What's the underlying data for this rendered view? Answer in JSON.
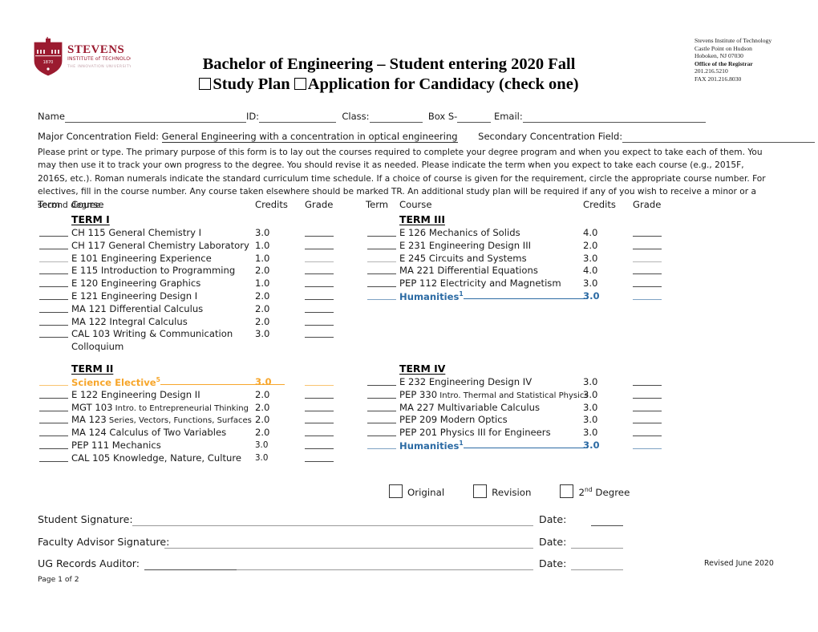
{
  "header": {
    "logo_name": "stevens-institute-logo",
    "logo_text_primary": "STEVENS",
    "logo_text_secondary": "INSTITUTE of TECHNOLOGY",
    "logo_text_tertiary": "THE INNOVATION UNIVERSITY",
    "logo_color": "#9B1B30",
    "title_line1": "Bachelor of Engineering – Student entering 2020 Fall",
    "checkbox1_label": "Study Plan",
    "checkbox2_label": "Application for Candidacy (check one)",
    "registrar": {
      "line1": "Stevens Institute of Technology",
      "line2": "Castle Point on Hudson",
      "line3": "Hoboken, NJ 07030",
      "line4": "Office of the Registrar",
      "line5": "201.216.5210",
      "line6": "FAX 201.216.8030"
    }
  },
  "identity": {
    "name_label": "Name",
    "id_label": "ID:",
    "class_label": "Class:",
    "box_label": "Box S-",
    "email_label": "Email:",
    "major_label": "Major Concentration Field:",
    "major_value": "General Engineering with a concentration in optical engineering",
    "secondary_label": "Secondary Concentration Field:"
  },
  "instructions": "Please print or type. The primary purpose of this form is to lay out the courses required to complete your degree program and when you expect to take each of them. You may then use it to track your own progress to the degree. You should revise it as needed. Please indicate the term when you expect to take each course (e.g., 2015F, 2016S, etc.). Roman numerals indicate the standard curriculum time schedule. If a choice of course is given for the requirement, circle the appropriate course number. For electives, fill in the course number. Any course taken elsewhere should be marked TR. An additional study plan will be required if any of you wish to receive a minor or a second degree.",
  "columns": {
    "term": "Term",
    "course": "Course",
    "credits": "Credits",
    "grade": "Grade"
  },
  "colors": {
    "accent_blue": "#2C6BA4",
    "accent_orange": "#F7A62B",
    "brand_maroon": "#9B1B30"
  },
  "terms": {
    "term1": {
      "heading": "TERM I",
      "rows": [
        {
          "course": "CH 115 General Chemistry I",
          "credits": "3.0"
        },
        {
          "course": "CH 117 General Chemistry Laboratory",
          "credits": "1.0"
        },
        {
          "course": "E 101 Engineering Experience",
          "credits": "1.0",
          "faint": true
        },
        {
          "course": "E 115 Introduction to Programming",
          "credits": "2.0"
        },
        {
          "course": "E 120 Engineering Graphics",
          "credits": "1.0"
        },
        {
          "course": "E 121 Engineering Design I",
          "credits": "2.0"
        },
        {
          "course": "MA 121 Differential Calculus",
          "credits": "2.0"
        },
        {
          "course": "MA 122 Integral Calculus",
          "credits": "2.0"
        },
        {
          "course": "CAL 103 Writing & Communication",
          "credits": "3.0",
          "continuation": "Colloquium"
        }
      ]
    },
    "term2": {
      "heading": "TERM II",
      "rows": [
        {
          "course": "Science Elective",
          "sup": "5",
          "fill": true,
          "credits": "3.0",
          "accent": "orange"
        },
        {
          "course": "E 122 Engineering Design II",
          "credits": "2.0"
        },
        {
          "course": "MGT 103",
          "detail": "Intro. to Entrepreneurial Thinking",
          "credits": "2.0"
        },
        {
          "course": "MA 123",
          "detail": "Series, Vectors, Functions, Surfaces",
          "credits": "2.0"
        },
        {
          "course": "MA 124 Calculus of Two Variables",
          "credits": "2.0"
        },
        {
          "course": "PEP 111 Mechanics",
          "credits": "3.0",
          "credits_small": true
        },
        {
          "course": "CAL 105 Knowledge, Nature, Culture",
          "credits": "3.0",
          "credits_small": true
        }
      ]
    },
    "term3": {
      "heading": "TERM III",
      "rows": [
        {
          "course": "E 126 Mechanics of Solids",
          "credits": "4.0"
        },
        {
          "course": "E 231 Engineering Design III",
          "credits": "2.0"
        },
        {
          "course": "E 245 Circuits and Systems",
          "credits": "3.0",
          "faint": true
        },
        {
          "course": "MA 221 Differential Equations",
          "credits": "4.0"
        },
        {
          "course": "PEP 112 Electricity and Magnetism",
          "credits": "3.0"
        },
        {
          "course": "Humanities",
          "sup": "1",
          "fill": true,
          "credits": "3.0",
          "accent": "blue"
        }
      ]
    },
    "term4": {
      "heading": "TERM IV",
      "rows": [
        {
          "course": "E 232 Engineering Design IV",
          "credits": "3.0"
        },
        {
          "course": "PEP 330",
          "detail": "Intro. Thermal and Statistical Physics",
          "credits": "3.0"
        },
        {
          "course": "MA 227 Multivariable Calculus",
          "credits": "3.0"
        },
        {
          "course": "PEP 209 Modern Optics",
          "credits": "3.0"
        },
        {
          "course": "PEP 201 Physics III for Engineers",
          "credits": "3.0"
        },
        {
          "course": "Humanities",
          "sup": "1",
          "fill": true,
          "credits": "3.0",
          "accent": "blue"
        }
      ]
    }
  },
  "options": [
    {
      "label": "Original"
    },
    {
      "label": "Revision"
    },
    {
      "label": "2",
      "sup": "nd",
      "label_after": " Degree"
    }
  ],
  "signatures": {
    "student_label": "Student Signature:",
    "faculty_label": "Faculty Advisor Signature:",
    "auditor_label": "UG Records Auditor: ",
    "date_label": "Date:"
  },
  "footer": {
    "page": "Page 1 of 2",
    "revised": "Revised June 2020"
  }
}
